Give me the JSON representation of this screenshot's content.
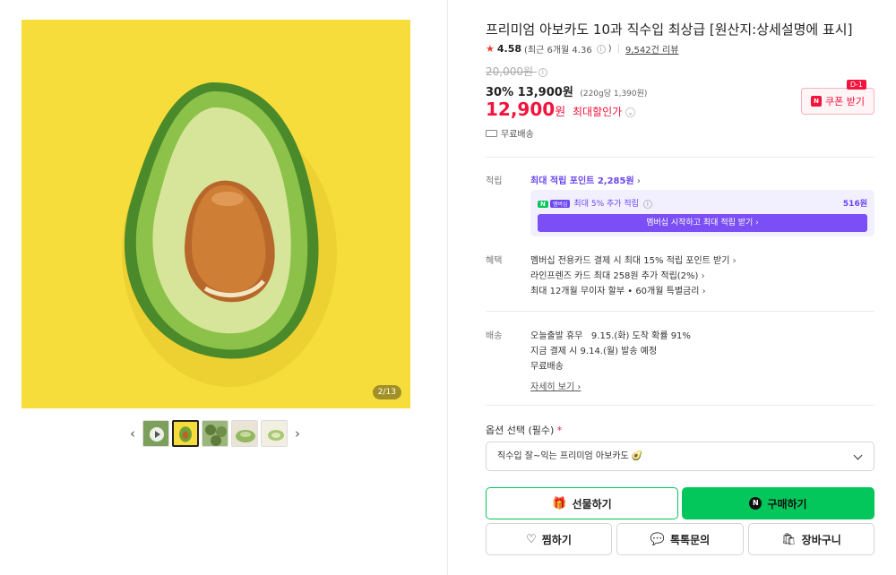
{
  "gallery": {
    "counter": "2/13",
    "prev_icon": "chevron-left-icon",
    "next_icon": "chevron-right-icon",
    "background_color": "#f7dd3c"
  },
  "product": {
    "title": "프리미엄 아보카도 10과 직수입 최상급 [원산지:상세설명에 표시]",
    "rating": "4.58",
    "rating_recent": "(최근 6개월 4.36",
    "rating_recent_close": ")",
    "reviews": "9,542건 리뷰",
    "original_price": "20,000원",
    "discount": "30%",
    "sale_price": "13,900원",
    "unit_price": "(220g당 1,390원)",
    "max_price": "12,900",
    "max_price_won": "원",
    "max_price_label": "최대할인가",
    "coupon_label": "쿠폰 받기",
    "coupon_badge": "D-1",
    "free_shipping": "무료배송"
  },
  "points": {
    "label": "적립",
    "max_points": "최대 적립 포인트 2,285원",
    "member_tag_n": "N",
    "member_tag": "멤버십",
    "member_extra": "최대 5% 추가 적립",
    "member_amount": "516원",
    "member_button": "멤버십 시작하고 최대 적립 받기"
  },
  "benefits": {
    "label": "혜택",
    "items": [
      "멤버십 전용카드 결제 시 최대 15% 적립 포인트 받기",
      "라인프렌즈 카드 최대 258원 추가 적립(2%)",
      "최대 12개월 무이자 할부 • 60개월 특별금리"
    ]
  },
  "delivery": {
    "label": "배송",
    "line1": "오늘출발 휴무   9.15.(화) 도착 확률 91%",
    "line2": "지금 결제 시 9.14.(월) 발송 예정",
    "line3": "무료배송",
    "detail_link": "자세히 보기"
  },
  "option": {
    "label": "옵션 선택 (필수)",
    "required_mark": "*",
    "selected": "직수입 잘~익는 프리미엄 아보카도 🥑"
  },
  "actions": {
    "gift": "선물하기",
    "buy": "구매하기",
    "wish": "찜하기",
    "talk": "톡톡문의",
    "cart": "장바구니"
  },
  "colors": {
    "accent_green": "#03c75a",
    "price_red": "#f2143c",
    "membership_purple": "#6b45f0"
  }
}
